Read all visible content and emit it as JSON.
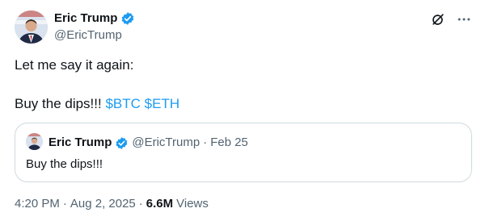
{
  "author": {
    "name": "Eric Trump",
    "handle": "@EricTrump",
    "verified_color": "#1d9bf0"
  },
  "icons": [
    "grok-icon",
    "more-icon"
  ],
  "post": {
    "line1": "Let me say it again:",
    "line2_text": "Buy the dips!!! ",
    "cashtags": [
      "$BTC",
      "$ETH"
    ],
    "cashtag_color": "#1d9bf0"
  },
  "quote": {
    "name": "Eric Trump",
    "handle": "@EricTrump",
    "separator": "·",
    "date": "Feb 25",
    "text": "Buy the dips!!!"
  },
  "meta": {
    "time": "4:20 PM",
    "separator": "·",
    "date": "Aug 2, 2025",
    "views_count": "6.6M",
    "views_label": "Views"
  }
}
